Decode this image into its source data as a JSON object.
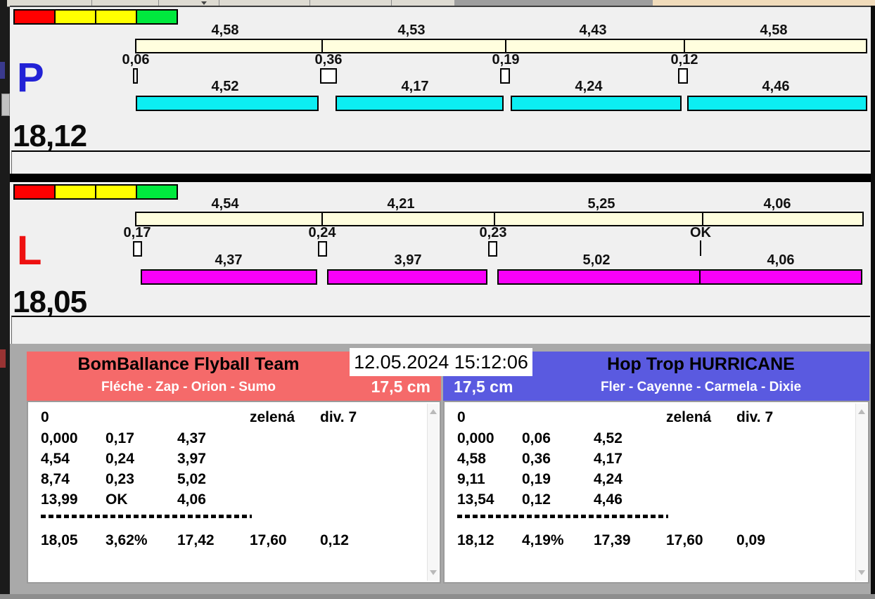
{
  "timestamp": "12.05.2024 15:12:06",
  "lanes": [
    {
      "id": "P",
      "letter": "P",
      "total": "18,12",
      "split_times": [
        "4,58",
        "4,53",
        "4,43",
        "4,58"
      ],
      "gap_times": [
        "0,06",
        "0,36",
        "0,19",
        "0,12"
      ],
      "run_times": [
        "4,52",
        "4,17",
        "4,24",
        "4,46"
      ]
    },
    {
      "id": "L",
      "letter": "L",
      "total": "18,05",
      "split_times": [
        "4,54",
        "4,21",
        "5,25",
        "4,06"
      ],
      "gap_times": [
        "0,17",
        "0,24",
        "0,23",
        "OK"
      ],
      "run_times": [
        "4,37",
        "3,97",
        "5,02",
        "4,06"
      ]
    }
  ],
  "teams": [
    {
      "name": "BomBallance Flyball Team",
      "lineup": "Fléche - Zap - Orion - Sumo",
      "jump_height": "17,5 cm",
      "results": {
        "header_row": {
          "start": "0",
          "light": "zelená",
          "division": "div. 7"
        },
        "runs": [
          [
            "0,000",
            "0,17",
            "4,37"
          ],
          [
            "4,54",
            "0,24",
            "3,97"
          ],
          [
            "8,74",
            "0,23",
            "5,02"
          ],
          [
            "13,99",
            "OK",
            "4,06"
          ]
        ],
        "summary": [
          "18,05",
          "3,62%",
          "17,42",
          "17,60",
          "0,12"
        ]
      }
    },
    {
      "name": "Hop Trop HURRICANE",
      "lineup": "Fler - Cayenne - Carmela - Dixie",
      "jump_height": "17,5 cm",
      "results": {
        "header_row": {
          "start": "0",
          "light": "zelená",
          "division": "div. 7"
        },
        "runs": [
          [
            "0,000",
            "0,06",
            "4,52"
          ],
          [
            "4,58",
            "0,36",
            "4,17"
          ],
          [
            "9,11",
            "0,19",
            "4,24"
          ],
          [
            "13,54",
            "0,12",
            "4,46"
          ]
        ],
        "summary": [
          "18,12",
          "4,19%",
          "17,39",
          "17,60",
          "0,09"
        ]
      }
    }
  ],
  "colors": {
    "lane_p_bar": "#0CEEF2",
    "lane_l_bar": "#F800F8",
    "ruler_bar": "#FFFEDE",
    "team_left_header": "#F56A6A",
    "team_right_header": "#5A5AE0",
    "light_red": "#FF0000",
    "light_yellow": "#FFFF00",
    "light_green": "#00E93E",
    "lane_p_letter": "#2222D6",
    "lane_l_letter": "#EE1111"
  }
}
